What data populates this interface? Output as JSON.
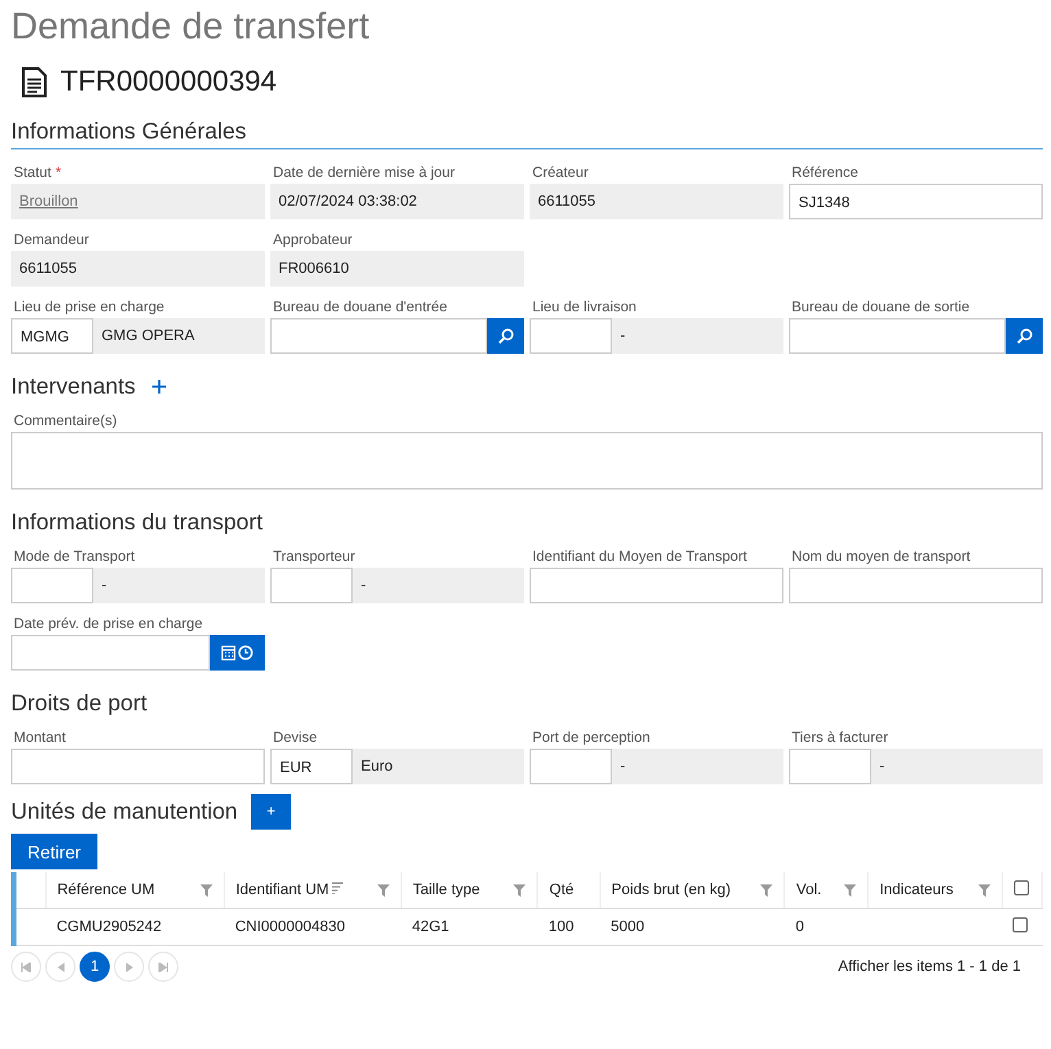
{
  "title": "Demande de transfert",
  "document": {
    "number": "TFR0000000394"
  },
  "sections": [
    {
      "title": "Informations Générales",
      "underline": true,
      "rows": [
        [
          {
            "label": "Statut",
            "required_mark": "*",
            "kind": "link",
            "value": "Brouillon"
          },
          {
            "label": "Date de dernière mise à jour",
            "kind": "readonly",
            "value": "02/07/2024 03:38:02"
          },
          {
            "label": "Créateur",
            "kind": "readonly",
            "value": "6611055"
          },
          {
            "label": "Référence",
            "kind": "input",
            "value": "SJ1348"
          }
        ],
        [
          {
            "label": "Demandeur",
            "kind": "readonly",
            "value": "6611055"
          },
          {
            "label": "Approbateur",
            "kind": "readonly",
            "value": "FR006610"
          }
        ],
        [
          {
            "label": "Lieu de prise en charge",
            "kind": "code",
            "code": "MGMG",
            "description": "GMG OPERA"
          },
          {
            "label": "Bureau de douane d'entrée",
            "kind": "search"
          },
          {
            "label": "Lieu de livraison",
            "kind": "code",
            "description": "-"
          },
          {
            "label": "Bureau de douane de sortie",
            "kind": "search"
          }
        ]
      ]
    },
    {
      "title": "Intervenants",
      "underline": false,
      "add_icon": true,
      "rows": [
        [
          {
            "label": "Commentaire(s)",
            "kind": "textarea"
          }
        ]
      ]
    },
    {
      "title": "Informations du transport",
      "underline": false,
      "rows": [
        [
          {
            "label": "Mode de Transport",
            "kind": "code",
            "description": "-"
          },
          {
            "label": "Transporteur",
            "kind": "code",
            "description": "-"
          },
          {
            "label": "Identifiant du Moyen de Transport",
            "kind": "input"
          },
          {
            "label": "Nom du moyen de transport",
            "kind": "input"
          }
        ],
        [
          {
            "label": "Date prév. de prise en charge",
            "kind": "date"
          }
        ]
      ]
    },
    {
      "title": "Droits de port",
      "underline": false,
      "rows": [
        [
          {
            "label": "Montant",
            "kind": "input"
          },
          {
            "label": "Devise",
            "kind": "code",
            "code": "EUR",
            "description": "Euro"
          },
          {
            "label": "Port de perception",
            "kind": "code",
            "description": "-"
          },
          {
            "label": "Tiers à facturer",
            "kind": "code",
            "description": "-"
          }
        ]
      ]
    }
  ],
  "handling_units": {
    "title": "Unités de manutention",
    "add_label": "+",
    "remove_label": "Retirer",
    "columns": [
      {
        "label": "Référence UM",
        "sort": false,
        "filter": true
      },
      {
        "label": "Identifiant UM",
        "sort": true,
        "filter": true
      },
      {
        "label": "Taille type",
        "sort": false,
        "filter": true
      },
      {
        "label": "Qté",
        "sort": false,
        "filter": false
      },
      {
        "label": "Poids brut (en kg)",
        "sort": false,
        "filter": true
      },
      {
        "label": "Vol.",
        "sort": false,
        "filter": true
      },
      {
        "label": "Indicateurs",
        "sort": false,
        "filter": true
      }
    ],
    "select_all": false,
    "rows": [
      {
        "cells": [
          "CGMU2905242",
          "CNI0000004830",
          "42G1",
          "100",
          "5000",
          "0"
        ],
        "checked": false
      }
    ],
    "pager": {
      "pages": [
        {
          "label": "1",
          "selected": true
        }
      ],
      "summary": "Afficher les items 1 - 1 de 1"
    }
  }
}
